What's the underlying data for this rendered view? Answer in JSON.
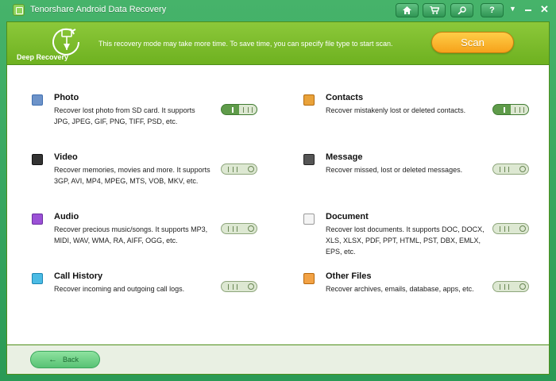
{
  "window": {
    "title": "Tenorshare Android Data Recovery"
  },
  "titlebar": {
    "buttons": [
      {
        "icon": "home-icon"
      },
      {
        "icon": "cart-icon"
      },
      {
        "icon": "key-icon"
      },
      {
        "icon": "help-icon",
        "label": "?"
      }
    ]
  },
  "header": {
    "mode_label": "Deep Recovery",
    "message": "This recovery mode may take more time. To save time, you can specify file type to start scan.",
    "scan_label": "Scan"
  },
  "items": [
    {
      "name": "Photo",
      "desc": "Recover lost photo from SD card. It supports JPG, JPEG, GIF, PNG, TIFF, PSD, etc.",
      "enabled": true,
      "icon": "photo-icon",
      "color": "#3f6fb0"
    },
    {
      "name": "Contacts",
      "desc": "Recover mistakenly lost or deleted contacts.",
      "enabled": true,
      "icon": "contacts-icon",
      "color": "#d9891b"
    },
    {
      "name": "Video",
      "desc": "Recover memories, movies and more. It supports 3GP, AVI, MP4, MPEG, MTS, VOB, MKV, etc.",
      "enabled": false,
      "icon": "video-icon",
      "color": "#333333"
    },
    {
      "name": "Message",
      "desc": "Recover missed, lost or deleted messages.",
      "enabled": false,
      "icon": "message-icon",
      "color": "#444444"
    },
    {
      "name": "Audio",
      "desc": "Recover precious music/songs. It supports MP3, MIDI, WAV, WMA, RA, AIFF, OGG, etc.",
      "enabled": false,
      "icon": "audio-icon",
      "color": "#8a3fc7"
    },
    {
      "name": "Document",
      "desc": "Recover lost documents. It supports DOC, DOCX, XLS, XLSX, PDF, PPT, HTML, PST, DBX, EMLX, EPS, etc.",
      "enabled": false,
      "icon": "document-icon",
      "color": "#c9c9c9"
    },
    {
      "name": "Call History",
      "desc": "Recover incoming and outgoing call logs.",
      "enabled": false,
      "icon": "phone-icon",
      "color": "#2aa6d8"
    },
    {
      "name": "Other Files",
      "desc": "Recover archives, emails, database, apps, etc.",
      "enabled": false,
      "icon": "tools-icon",
      "color": "#e98a1c"
    }
  ],
  "footer": {
    "back_label": "Back"
  },
  "colors": {
    "accent_green": "#6eb120",
    "scan_orange": "#f6a21b",
    "toggle_on": "#5f9b4a"
  }
}
